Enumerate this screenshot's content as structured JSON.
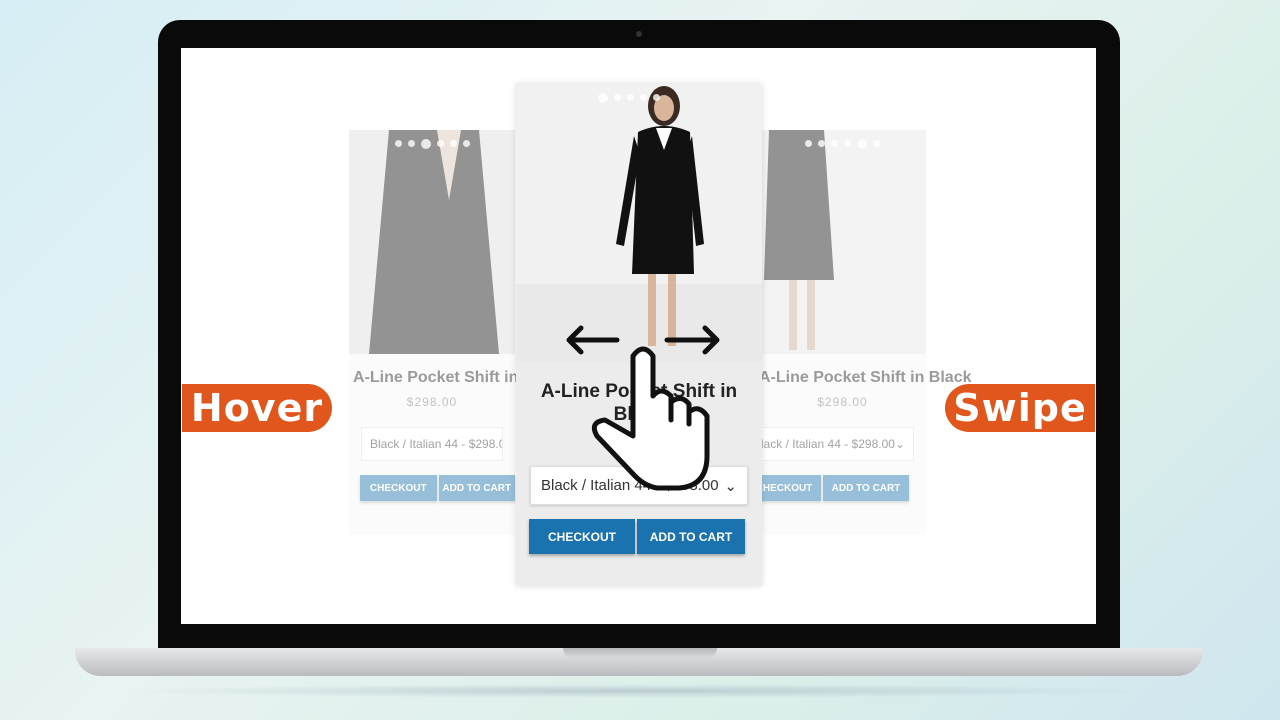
{
  "labels": {
    "hover": "Hover",
    "swipe": "Swipe"
  },
  "product": {
    "title": "A-Line Pocket Shift in Black",
    "price": "$298.00",
    "variant": "Black / Italian 44 - $298.00",
    "checkout": "CHECKOUT",
    "add_to_cart": "ADD TO CART"
  },
  "left_card": {
    "title": "A-Line Pocket Shift in Black",
    "price": "$298.00",
    "variant": "Black / Italian 44 - $298.00",
    "checkout": "CHECKOUT",
    "add_to_cart": "ADD TO CART"
  },
  "right_card": {
    "title": "A-Line Pocket Shift in Black",
    "price": "$298.00",
    "variant": "Black / Italian 44 - $298.00",
    "checkout": "CHECKOUT",
    "add_to_cart": "ADD TO CART"
  },
  "colors": {
    "accent": "#1a72ae",
    "badge": "#e0561c"
  },
  "icons": {
    "gesture": "swipe-hand-icon",
    "select": "chevron-down-icon"
  }
}
